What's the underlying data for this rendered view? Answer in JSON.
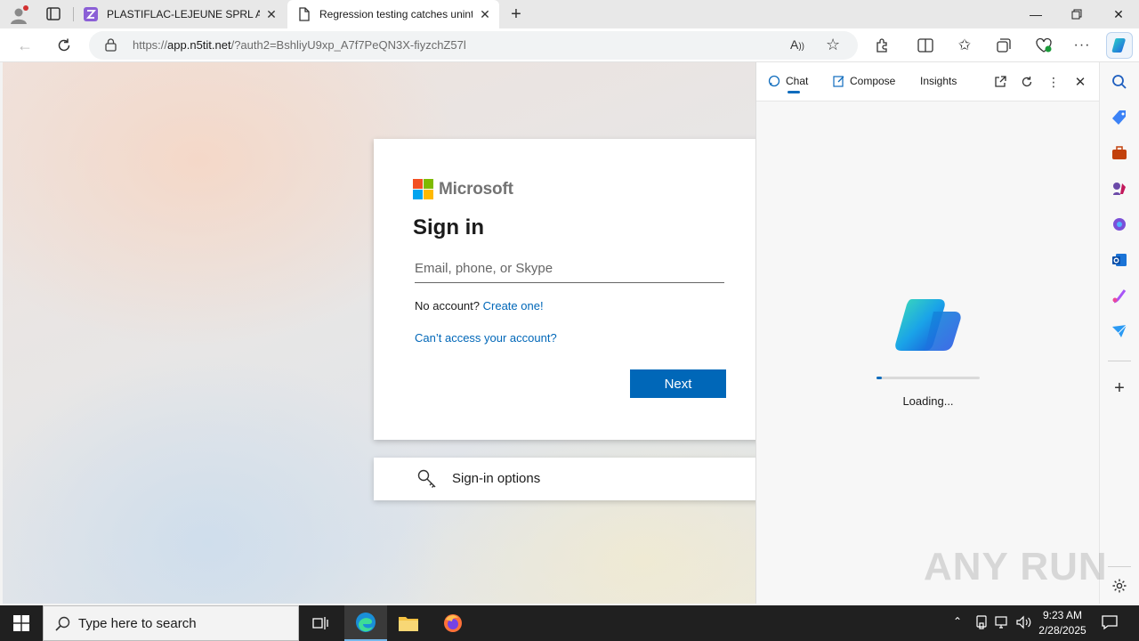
{
  "browser": {
    "tabs": [
      {
        "title": "PLASTIFLAC-LEJEUNE SPRL Accè",
        "active": false
      },
      {
        "title": "Regression testing catches unint",
        "active": true
      }
    ],
    "address": {
      "scheme": "https://",
      "host": "app.n5tit.net",
      "path": "/?auth2=BshliyU9xp_A7f7PeQN3X-fiyzchZ57l"
    }
  },
  "signin": {
    "brand": "Microsoft",
    "title": "Sign in",
    "email_placeholder": "Email, phone, or Skype",
    "no_account": "No account?",
    "create_link": "Create one!",
    "cant_access": "Can’t access your account?",
    "next_label": "Next",
    "options_label": "Sign-in options"
  },
  "copilot_pane": {
    "tabs": [
      "Chat",
      "Compose",
      "Insights"
    ],
    "active_tab": "Chat",
    "loading_text": "Loading...",
    "loading_progress": 0.05
  },
  "watermark": "ANY RUN",
  "taskbar": {
    "search_placeholder": "Type here to search",
    "time": "9:23 AM",
    "date": "2/28/2025"
  },
  "colors": {
    "accent": "#0067b8",
    "ms_red": "#f25022",
    "ms_green": "#7fba00",
    "ms_blue": "#00a4ef",
    "ms_yellow": "#ffb900"
  }
}
